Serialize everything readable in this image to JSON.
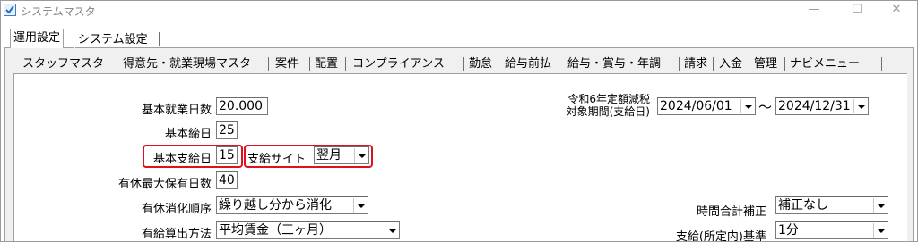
{
  "window": {
    "title": "システムマスタ",
    "minimize": "—",
    "maximize": "☐",
    "close": "✕"
  },
  "outer_tabs": [
    "運用設定",
    "システム設定"
  ],
  "inner_tabs": [
    "スタッフマスタ",
    "得意先・就業現場マスタ",
    "案件",
    "配置",
    "コンプライアンス",
    "勤怠",
    "給与前払",
    "給与・賞与・年調",
    "請求",
    "入金",
    "管理",
    "ナビメニュー"
  ],
  "form": {
    "basic_work_days_label": "基本就業日数",
    "basic_work_days_value": "20.000",
    "basic_close_day_label": "基本締日",
    "basic_close_day_value": "25",
    "basic_pay_day_label": "基本支給日",
    "basic_pay_day_value": "15",
    "pay_site_label": "支給サイト",
    "pay_site_value": "翌月",
    "max_paid_leave_label": "有休最大保有日数",
    "max_paid_leave_value": "40",
    "leave_order_label": "有休消化順序",
    "leave_order_value": "繰り越し分から消化",
    "paid_calc_label": "有給算出方法",
    "paid_calc_value": "平均賃金（三ヶ月）",
    "tax_period_label_1": "令和6年定額減税",
    "tax_period_label_2": "対象期間(支給日)",
    "tax_period_from": "2024/06/01",
    "tax_period_sep": "〜",
    "tax_period_to": "2024/12/31",
    "time_total_label": "時間合計補正",
    "time_total_value": "補正なし",
    "pay_basis_label": "支給(所定内)基準",
    "pay_basis_value": "1分"
  },
  "highlight_color": "#e01020"
}
